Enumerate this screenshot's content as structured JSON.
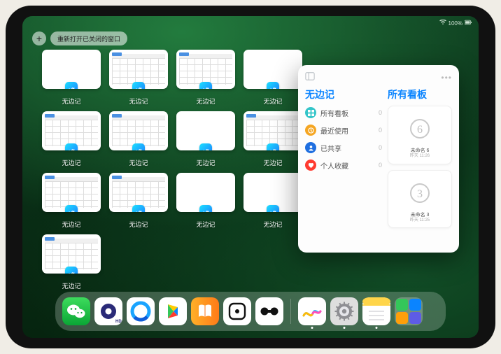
{
  "status": {
    "time": "",
    "battery": "100%"
  },
  "top_controls": {
    "add": "+",
    "recent_pill": "重新打开已关闭的窗口"
  },
  "thumb_label": "无边记",
  "thumbs": [
    {
      "variant": "blank"
    },
    {
      "variant": "cal"
    },
    {
      "variant": "cal"
    },
    {
      "variant": "blank"
    },
    {
      "variant": "cal"
    },
    {
      "variant": "cal"
    },
    {
      "variant": "blank"
    },
    {
      "variant": "cal"
    },
    {
      "variant": "cal"
    },
    {
      "variant": "cal"
    },
    {
      "variant": "blank"
    },
    {
      "variant": "blank"
    },
    {
      "variant": "cal"
    }
  ],
  "panel": {
    "left_title": "无边记",
    "right_title": "所有看板",
    "categories": [
      {
        "icon": "grid",
        "color": "#34c5c9",
        "label": "所有看板",
        "count": 0
      },
      {
        "icon": "clock",
        "color": "#f5a623",
        "label": "最近使用",
        "count": 0
      },
      {
        "icon": "person",
        "color": "#1f6fe0",
        "label": "已共享",
        "count": 0
      },
      {
        "icon": "heart",
        "color": "#ff3b30",
        "label": "个人收藏",
        "count": 0
      }
    ],
    "boards": [
      {
        "glyph": "6",
        "title": "未命名 6",
        "subtitle": "昨天 11:26"
      },
      {
        "glyph": "3",
        "title": "未命名 3",
        "subtitle": "昨天 11:25"
      }
    ]
  },
  "dock": {
    "icons": [
      {
        "name": "wechat"
      },
      {
        "name": "quark"
      },
      {
        "name": "qqbrowser"
      },
      {
        "name": "play"
      },
      {
        "name": "books"
      },
      {
        "name": "dice"
      },
      {
        "name": "dumbbell"
      }
    ],
    "recent": [
      {
        "name": "freeform"
      },
      {
        "name": "settings"
      },
      {
        "name": "notes"
      },
      {
        "name": "multitask"
      }
    ]
  }
}
